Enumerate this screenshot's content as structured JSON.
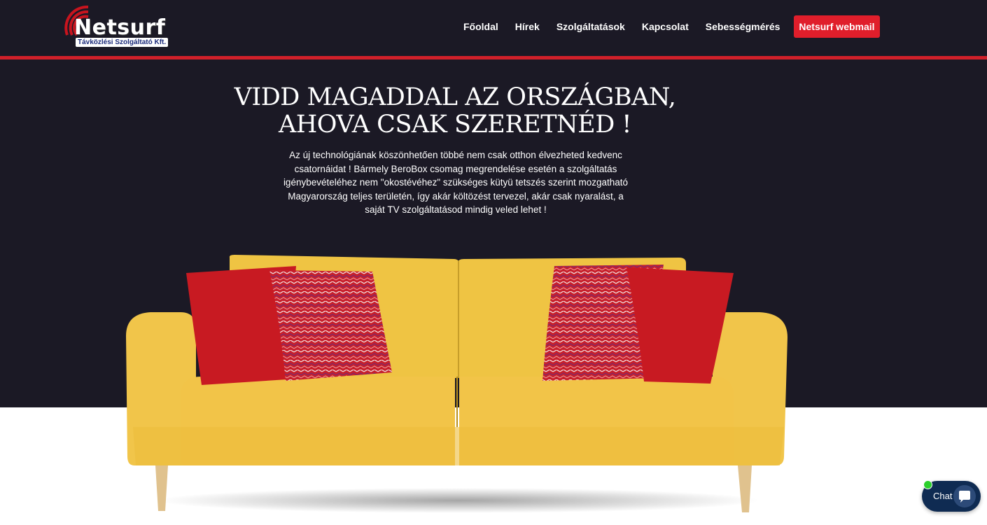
{
  "brand": {
    "name": "Netsurf",
    "tagline": "Távközlési Szolgáltató Kft."
  },
  "nav": {
    "items": [
      "Főoldal",
      "Hírek",
      "Szolgáltatások",
      "Kapcsolat",
      "Sebességmérés"
    ],
    "webmail": "Netsurf webmail"
  },
  "hero": {
    "title_line1": "VIDD MAGADDAL AZ ORSZÁGBAN,",
    "title_line2": "AHOVA CSAK SZERETNÉD !",
    "text": "Az új technológiának köszönhetően többé nem csak otthon élvezheted kedvenc csatornáidat ! Bármely BeroBox csomag megrendelése esetén a szolgáltatás igénybevételéhez nem \"okostévéhez\" szükséges kütyü tetszés szerint mozgatható Magyarország teljes területén, így akár költözést tervezel, akár csak nyaralást, a saját TV szolgáltatásod mindig veled lehet !"
  },
  "chat": {
    "label": "Chat",
    "icon": "chat-bubble-icon"
  },
  "colors": {
    "header_bg": "#1b1925",
    "accent_red": "#e01e2b",
    "chat_bg": "#0f2b52",
    "online_green": "#2bd02b"
  }
}
